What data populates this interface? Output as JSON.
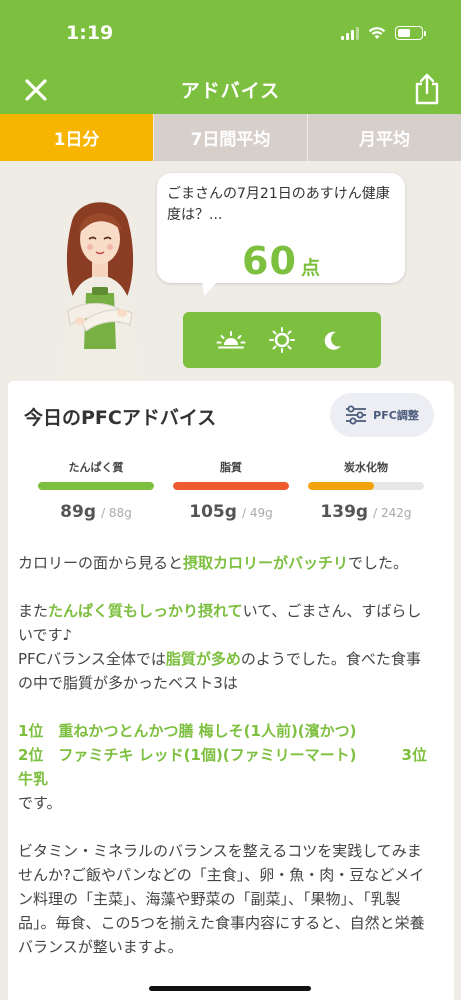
{
  "status_bar": {
    "time": "1:19"
  },
  "nav": {
    "title": "アドバイス"
  },
  "tabs": [
    {
      "label": "1日分",
      "active": true
    },
    {
      "label": "7日間平均",
      "active": false
    },
    {
      "label": "月平均",
      "active": false
    }
  ],
  "bubble": {
    "message": "ごまさんの7月21日のあすけん健康度は？...",
    "score": "60",
    "score_unit": "点"
  },
  "time_icons": [
    "morning-sun-icon",
    "noon-sun-icon",
    "night-moon-icon"
  ],
  "card": {
    "title": "今日のPFCアドバイス",
    "adjust_label": "PFC調整"
  },
  "nutrients": [
    {
      "label": "たんぱく質",
      "value": "89g",
      "target": "/ 88g",
      "fill": 1.0,
      "color": "#7dbf3f"
    },
    {
      "label": "脂質",
      "value": "105g",
      "target": "/ 49g",
      "fill": 1.0,
      "color": "#ee5b2f"
    },
    {
      "label": "炭水化物",
      "value": "139g",
      "target": "/ 242g",
      "fill": 0.57,
      "color": "#f2a20a"
    }
  ],
  "advice": {
    "p1_a": "カロリーの面から見ると",
    "p1_hl": "摂取カロリーがバッチリ",
    "p1_b": "でした。",
    "p2_a": "また",
    "p2_hl": "たんぱく質もしっかり摂れて",
    "p2_b": "いて、ごまさん、すばらしいです♪",
    "p2_c": "PFCバランス全体では",
    "p2_hl2": "脂質が多め",
    "p2_d": "のようでした。食べた食事の中で脂質が多かったベスト3は",
    "rank1": "1位　重ねかつとんかつ膳 梅しそ(1人前)(濱かつ)",
    "rank2": "2位　ファミチキ レッド(1個)(ファミリーマート)　　　3位　牛乳",
    "p3_end": "です。",
    "p4": "ビタミン・ミネラルのバランスを整えるコツを実践してみませんか?ご飯やパンなどの「主食」、卵・魚・肉・豆などメイン料理の「主菜」、海藻や野菜の「副菜」、「果物」、「乳製品」。毎食、この5つを揃えた食事内容にすると、自然と栄養バランスが整いますよ。"
  },
  "colors": {
    "brand": "#7dbf3f",
    "tab_active": "#f7b400",
    "tab_inactive": "#d6cfca"
  }
}
